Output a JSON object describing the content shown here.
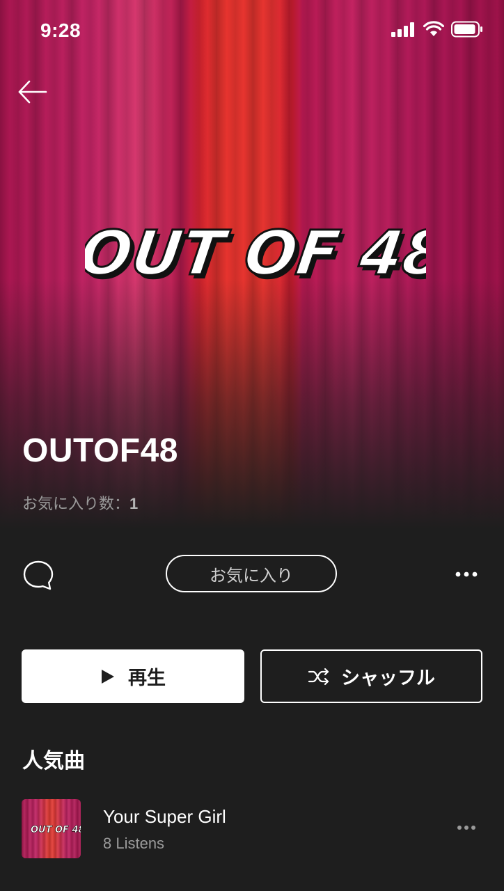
{
  "status_bar": {
    "time": "9:28"
  },
  "hero": {
    "logo_text": "OUT OF 48",
    "artist_name": "OUTOF48",
    "favorites_label": "お気に入り数：",
    "favorites_count": "1"
  },
  "actions": {
    "favorite_label": "お気に入り"
  },
  "playback": {
    "play_label": "再生",
    "shuffle_label": "シャッフル"
  },
  "popular": {
    "section_title": "人気曲",
    "tracks": [
      {
        "title": "Your Super Girl",
        "listens": "8 Listens"
      }
    ]
  },
  "colors": {
    "background": "#1e1e1e",
    "curtain_magenta": "#c22464",
    "curtain_red": "#e63a36",
    "text_secondary": "#9a9a9a"
  },
  "icons": {
    "back": "arrow-left-icon",
    "comment": "chat-bubble-icon",
    "more": "ellipsis-icon",
    "play": "play-icon",
    "shuffle": "shuffle-icon",
    "signal": "cellular-signal-icon",
    "wifi": "wifi-icon",
    "battery": "battery-icon"
  }
}
